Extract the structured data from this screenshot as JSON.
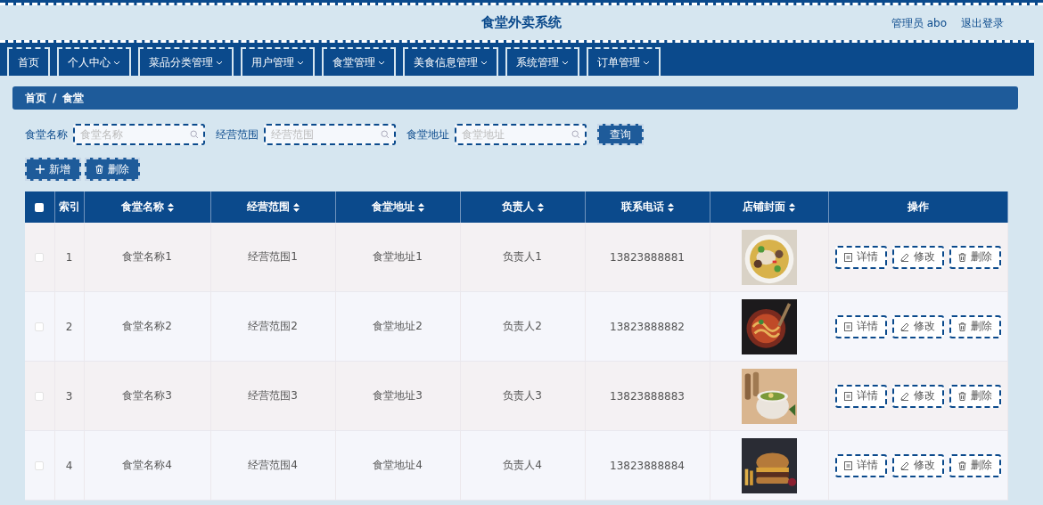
{
  "header": {
    "title": "食堂外卖系统",
    "user": "管理员 abo",
    "logout": "退出登录"
  },
  "nav": [
    {
      "label": "首页",
      "dropdown": false
    },
    {
      "label": "个人中心",
      "dropdown": true
    },
    {
      "label": "菜品分类管理",
      "dropdown": true
    },
    {
      "label": "用户管理",
      "dropdown": true
    },
    {
      "label": "食堂管理",
      "dropdown": true
    },
    {
      "label": "美食信息管理",
      "dropdown": true
    },
    {
      "label": "系统管理",
      "dropdown": true
    },
    {
      "label": "订单管理",
      "dropdown": true
    }
  ],
  "breadcrumb": {
    "items": [
      "首页",
      "食堂"
    ],
    "separator": "/"
  },
  "search": {
    "fields": [
      {
        "label": "食堂名称",
        "placeholder": "食堂名称"
      },
      {
        "label": "经营范围",
        "placeholder": "经营范围"
      },
      {
        "label": "食堂地址",
        "placeholder": "食堂地址"
      }
    ],
    "button": "查询"
  },
  "actions": [
    {
      "label": "新增"
    },
    {
      "label": "删除"
    }
  ],
  "table": {
    "select_all": {
      "checked": false
    },
    "columns": [
      {
        "label": "索引",
        "sortable": false
      },
      {
        "label": "食堂名称",
        "sortable": true
      },
      {
        "label": "经营范围",
        "sortable": true
      },
      {
        "label": "食堂地址",
        "sortable": true
      },
      {
        "label": "负责人",
        "sortable": true
      },
      {
        "label": "联系电话",
        "sortable": true
      },
      {
        "label": "店铺封面",
        "sortable": true
      },
      {
        "label": "操作",
        "sortable": false
      }
    ],
    "rows": [
      {
        "checked": false,
        "index": "1",
        "name": "食堂名称1",
        "scope": "经营范围1",
        "address": "食堂地址1",
        "manager": "负责人1",
        "phone": "13823888881",
        "cover": {
          "kind": "picture"
        },
        "actions": [
          "详情",
          "修改",
          "删除"
        ]
      },
      {
        "checked": false,
        "index": "2",
        "name": "食堂名称2",
        "scope": "经营范围2",
        "address": "食堂地址2",
        "manager": "负责人2",
        "phone": "13823888882",
        "cover": {
          "kind": "picture"
        },
        "actions": [
          "详情",
          "修改",
          "删除"
        ]
      },
      {
        "checked": false,
        "index": "3",
        "name": "食堂名称3",
        "scope": "经营范围3",
        "address": "食堂地址3",
        "manager": "负责人3",
        "phone": "13823888883",
        "cover": {
          "kind": "picture"
        },
        "actions": [
          "详情",
          "修改",
          "删除"
        ]
      },
      {
        "checked": false,
        "index": "4",
        "name": "食堂名称4",
        "scope": "经营范围4",
        "address": "食堂地址4",
        "manager": "负责人4",
        "phone": "13823888884",
        "cover": {
          "kind": "picture"
        },
        "actions": [
          "详情",
          "修改",
          "删除"
        ]
      }
    ]
  }
}
